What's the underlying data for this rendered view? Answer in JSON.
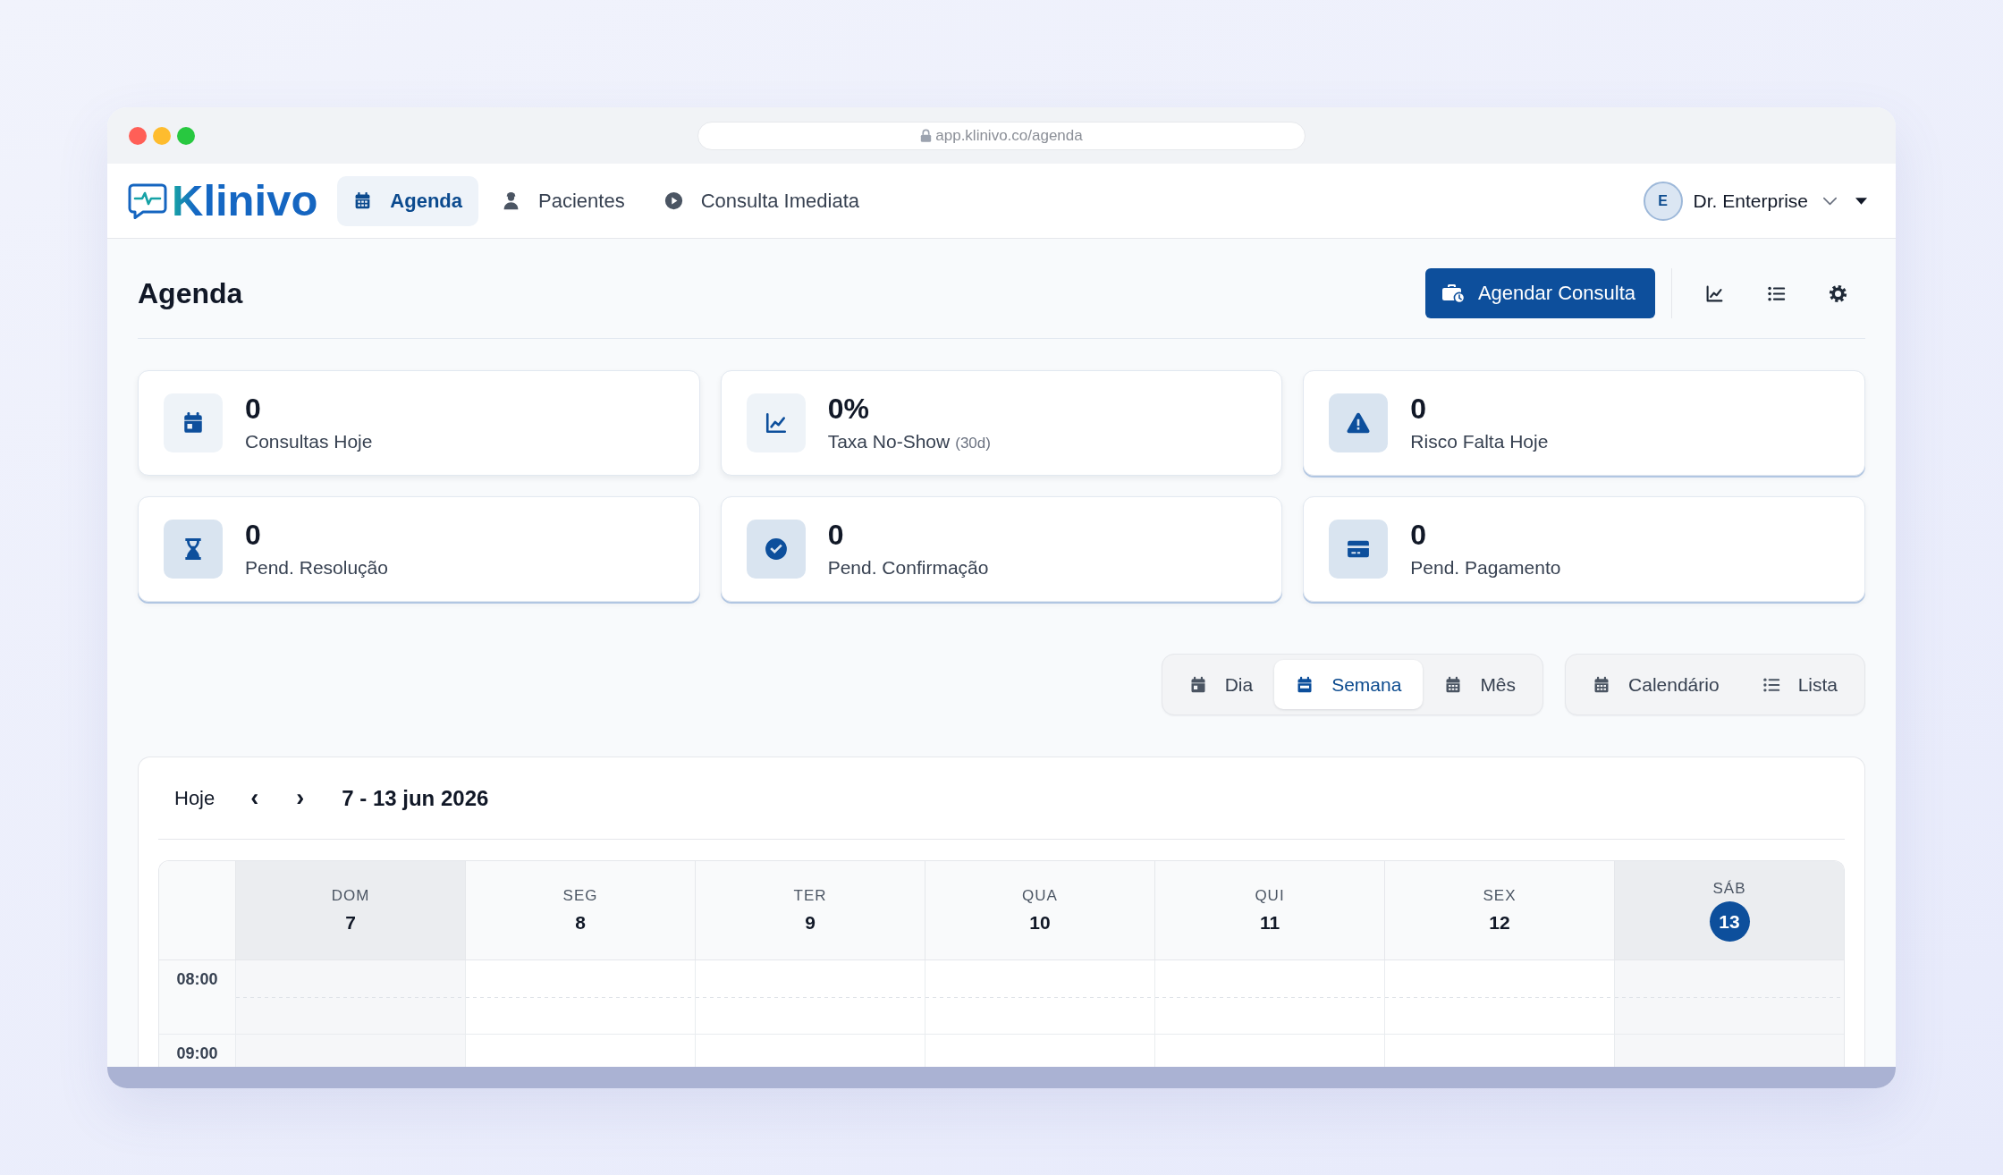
{
  "browser": {
    "url": "app.klinivo.co/agenda"
  },
  "nav": {
    "logo": "Klinivo",
    "items": [
      {
        "label": "Agenda",
        "selected": true
      },
      {
        "label": "Pacientes",
        "selected": false
      },
      {
        "label": "Consulta Imediata",
        "selected": false
      }
    ],
    "user": {
      "initial": "E",
      "name": "Dr. Enterprise"
    }
  },
  "page": {
    "title": "Agenda",
    "primary_button": "Agendar Consulta"
  },
  "stats": [
    {
      "value": "0",
      "label": "Consultas Hoje",
      "accent": false
    },
    {
      "value": "0%",
      "label": "Taxa No-Show",
      "note": "(30d)",
      "accent": false
    },
    {
      "value": "0",
      "label": "Risco Falta Hoje",
      "accent": true
    },
    {
      "value": "0",
      "label": "Pend. Resolução",
      "accent": true
    },
    {
      "value": "0",
      "label": "Pend. Confirmação",
      "accent": true
    },
    {
      "value": "0",
      "label": "Pend. Pagamento",
      "accent": true
    }
  ],
  "view_modes": [
    {
      "label": "Dia",
      "selected": false
    },
    {
      "label": "Semana",
      "selected": true
    },
    {
      "label": "Mês",
      "selected": false
    }
  ],
  "display_modes": [
    {
      "label": "Calendário"
    },
    {
      "label": "Lista"
    }
  ],
  "calendar": {
    "today_button": "Hoje",
    "prev": "‹",
    "next": "›",
    "range": "7 - 13 jun 2026",
    "days": [
      {
        "name": "DOM",
        "number": "7",
        "weekend": true,
        "today": false
      },
      {
        "name": "SEG",
        "number": "8",
        "weekend": false,
        "today": false
      },
      {
        "name": "TER",
        "number": "9",
        "weekend": false,
        "today": false
      },
      {
        "name": "QUA",
        "number": "10",
        "weekend": false,
        "today": false
      },
      {
        "name": "QUI",
        "number": "11",
        "weekend": false,
        "today": false
      },
      {
        "name": "SEX",
        "number": "12",
        "weekend": false,
        "today": false
      },
      {
        "name": "SÁB",
        "number": "13",
        "weekend": true,
        "today": true
      }
    ],
    "hours": [
      "08:00",
      "09:00"
    ]
  }
}
